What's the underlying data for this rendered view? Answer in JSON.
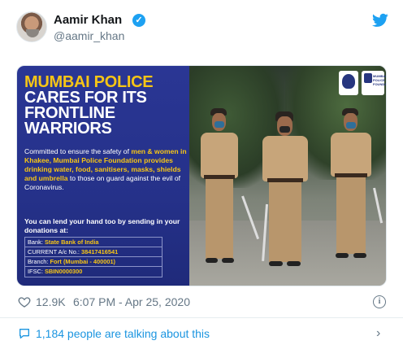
{
  "tweet": {
    "author_name": "Aamir Khan",
    "handle": "@aamir_khan",
    "verified_mark": "✓",
    "likes": "12.9K",
    "timestamp": "6:07 PM - Apr 25, 2020",
    "info_label": "i",
    "talking": "1,184 people are talking about this",
    "chevron": "›"
  },
  "poster": {
    "headline_yellow": "MUMBAI POLICE",
    "headline_white_1": "CARES FOR ITS",
    "headline_white_2": "FRONTLINE",
    "headline_white_3": "WARRIORS",
    "body_1": "Committed to ensure the safety of",
    "body_highlight": "men & women in Khakee, Mumbai Police Foundation provides drinking water, food, sanitisers, masks, shields and umbrella",
    "body_2": "to those on guard against the evil of Coronavirus.",
    "lend": "You can lend your hand too by sending in your donations at:",
    "bank_label": "Bank: ",
    "bank_value": "State Bank of India",
    "account_label": "CURRENT A/c No.: ",
    "account_value": "38417416541",
    "branch_label": "Branch: ",
    "branch_value": "Fort (Mumbai - 400001)",
    "ifsc_label": "IFSC: ",
    "ifsc_value": "SBIN0000300",
    "logo_text": "MUMBAI POLICE FOUNDATION"
  },
  "icons": {
    "twitter": "twitter-bird-icon",
    "heart": "heart-icon",
    "info": "info-icon",
    "talk": "speech-bubble-icon",
    "chevron": "chevron-right-icon"
  },
  "colors": {
    "accent": "#1da1f2",
    "link": "#1b95e0",
    "poster_blue": "#2a3694",
    "poster_yellow": "#f6c516",
    "muted": "#657786"
  }
}
